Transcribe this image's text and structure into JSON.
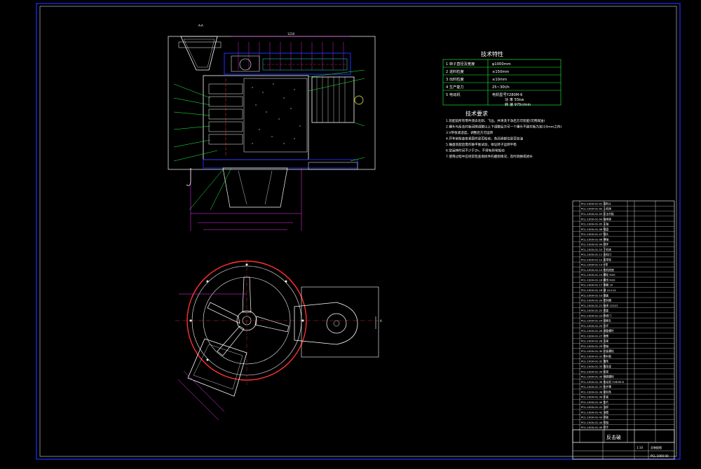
{
  "drawing": {
    "section_label": "A-A",
    "cut_label": "A",
    "colors": {
      "background": "#000000",
      "outline": "#ffffff",
      "blue": "#2030ff",
      "green": "#20ff40",
      "cyan": "#20e0e0",
      "magenta": "#ff30ff",
      "red": "#ff3030",
      "yellow": "#ffff40"
    }
  },
  "spec_table": {
    "title": "技术特性",
    "rows": [
      {
        "no": "1",
        "name": "转子直径及宽度",
        "value": "φ1000mm"
      },
      {
        "no": "2",
        "name": "进料粒度",
        "value": "≤150mm"
      },
      {
        "no": "3",
        "name": "出料粒度",
        "value": "≤10mm"
      },
      {
        "no": "4",
        "name": "生产能力",
        "value": "25~30t/h"
      },
      {
        "no": "5",
        "name": "电动机",
        "value": "电机型号Y280M-6",
        "value2": "功 率 55kw",
        "value3": "转 速 975r/min"
      }
    ]
  },
  "tech_notes": {
    "title": "技术要求",
    "items": [
      "1.装配前所有零件须去毛刺、飞边，并清洗干净后方可装配(可用煤油)",
      "2.锤头与反击衬板间隙调整以上下调整后方可一个锤头不碰衬板为宜(10mm之内)",
      "3.V带张紧适度，调整后方可运转",
      "4.开车前检查各紧固件是否松动，各润滑部位是否加油",
      "5.锤盘装配后需作静平衡试验，保证转子运转平稳",
      "6.空运转时间不少于2h，不得有异常振动",
      "7.使用过程中应经常检查易损件的磨损情况，及时调换或修补"
    ]
  },
  "parts_list": {
    "rows": [
      "PCL-1000-01-01 进料斗",
      "PCL-1000-01-02 上机体",
      "PCL-1000-01-03 反击衬板",
      "PCL-1000-01-04 轴承座",
      "PCL-1000-01-05 主轴",
      "PCL-1000-01-06 锤盘",
      "PCL-1000-01-07 锤头",
      "PCL-1000-01-08 锤轴",
      "PCL-1000-01-09 挡环",
      "PCL-1000-01-10 下机体",
      "PCL-1000-01-11 出料口",
      "PCL-1000-01-12 皮带轮",
      "PCL-1000-01-13 V带",
      "PCL-1000-01-14 电机底座",
      "PCL-1000-01-15 螺栓 M20",
      "PCL-1000-01-16 螺母 M20",
      "PCL-1000-01-17 垫圈 20",
      "PCL-1000-01-18 键 22×14",
      "PCL-1000-01-19 端盖",
      "PCL-1000-01-20 密封圈",
      "PCL-1000-01-21 轴承 22222",
      "PCL-1000-01-22 透盖",
      "PCL-1000-01-23 检修门",
      "PCL-1000-01-24 观察孔",
      "PCL-1000-01-25 吊环",
      "PCL-1000-01-26 调整螺杆",
      "PCL-1000-01-27 弹簧",
      "PCL-1000-01-28 支座",
      "PCL-1000-01-29 销轴",
      "PCL-1000-01-30 衬板螺栓",
      "PCL-1000-01-31 侧衬板",
      "PCL-1000-01-32 篦条",
      "PCL-1000-01-33 篦条架",
      "PCL-1000-01-34 机架",
      "PCL-1000-01-35 地脚螺栓",
      "PCL-1000-01-36 电动机 Y280M-6",
      "PCL-1000-01-37 防护罩",
      "PCL-1000-01-38 密封条",
      "PCL-1000-01-39 压板",
      "PCL-1000-01-40 垫片",
      "PCL-1000-01-41 油杯",
      "PCL-1000-01-42 油管",
      "PCL-1000-01-43 挡板",
      "PCL-1000-01-44 铰链",
      "PCL-1000-01-45 把手"
    ]
  },
  "title_block": {
    "drawing_name": "反击破",
    "assembly_label": "总装配图",
    "drawing_no": "PCL-1000-00",
    "scale": "1:10"
  }
}
